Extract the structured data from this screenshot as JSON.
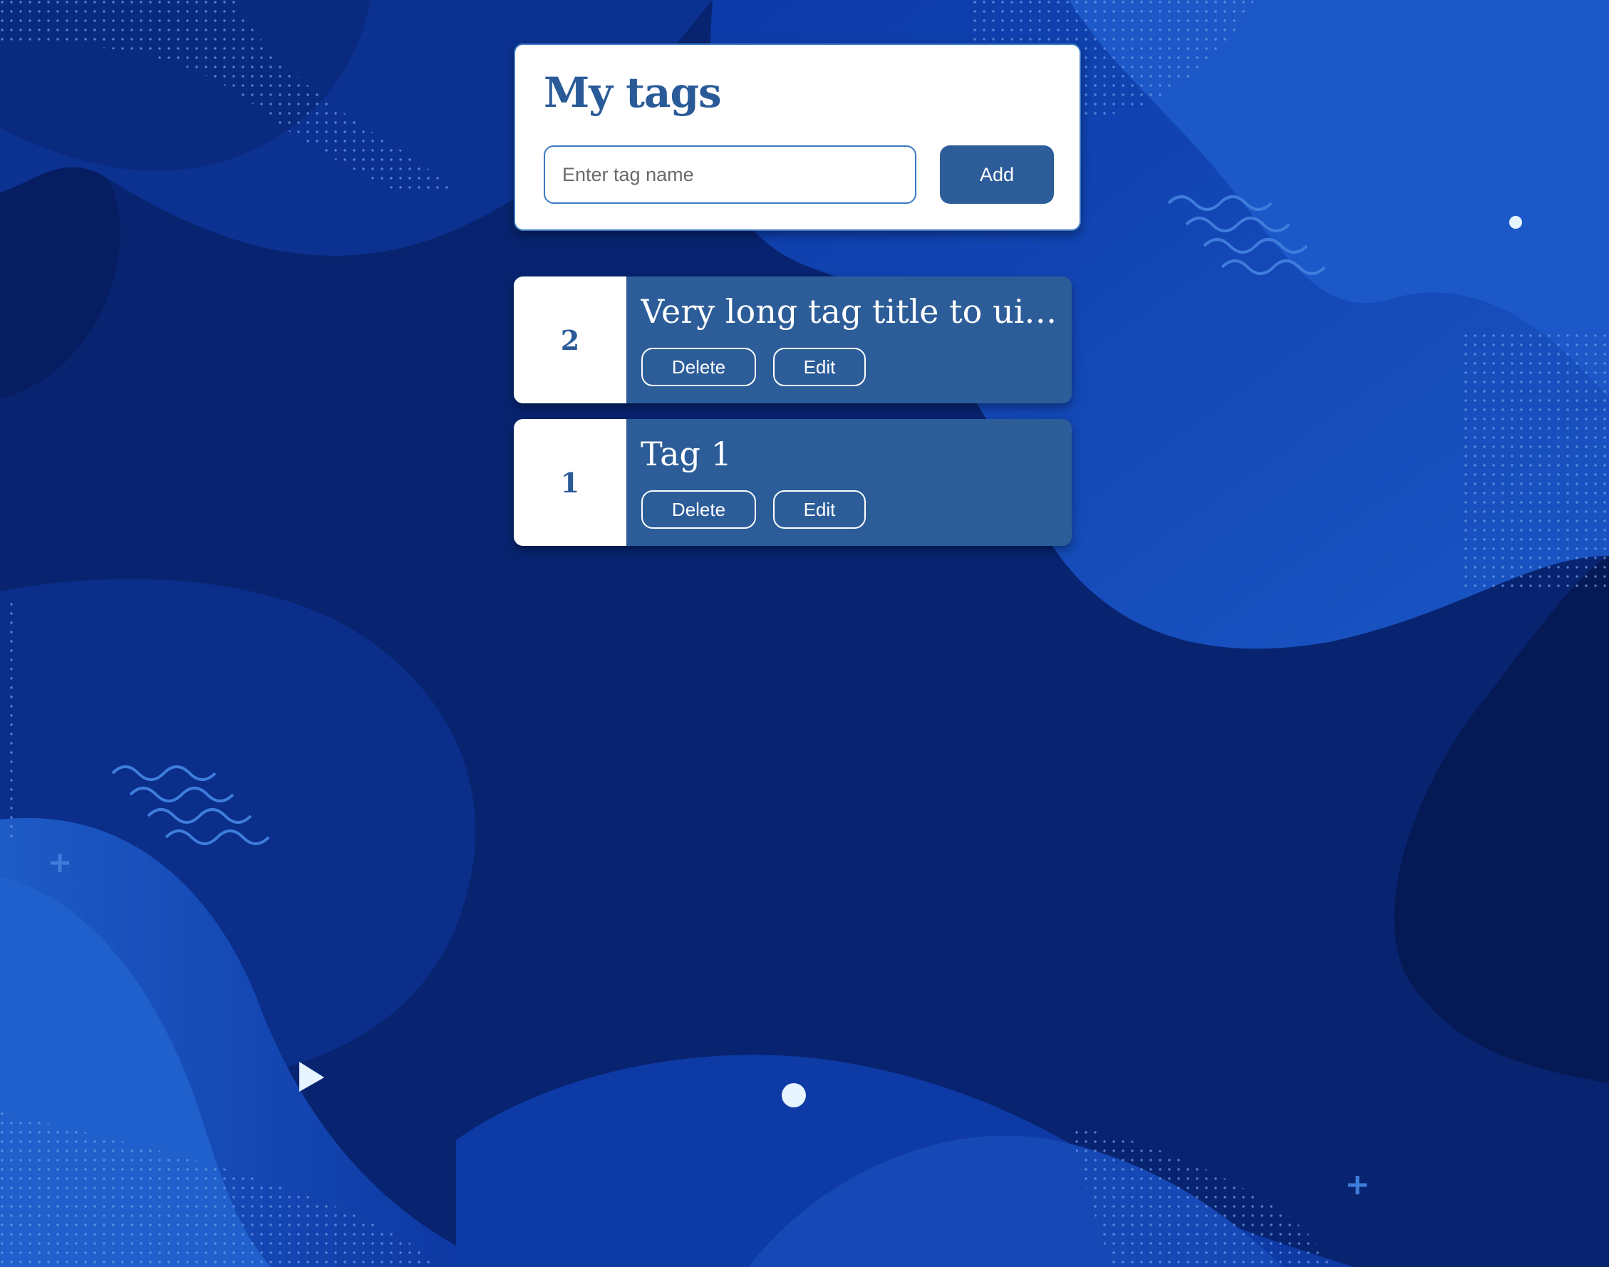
{
  "header": {
    "title": "My tags",
    "input_placeholder": "Enter tag name",
    "input_value": "",
    "add_label": "Add"
  },
  "tags": [
    {
      "number": "2",
      "title": "Very long tag title to ui h...",
      "delete_label": "Delete",
      "edit_label": "Edit"
    },
    {
      "number": "1",
      "title": "Tag 1",
      "delete_label": "Delete",
      "edit_label": "Edit"
    }
  ],
  "colors": {
    "accent": "#2c5d99",
    "title": "#2a5b98",
    "background_dark": "#082470",
    "background_light": "#1a4fb8"
  }
}
